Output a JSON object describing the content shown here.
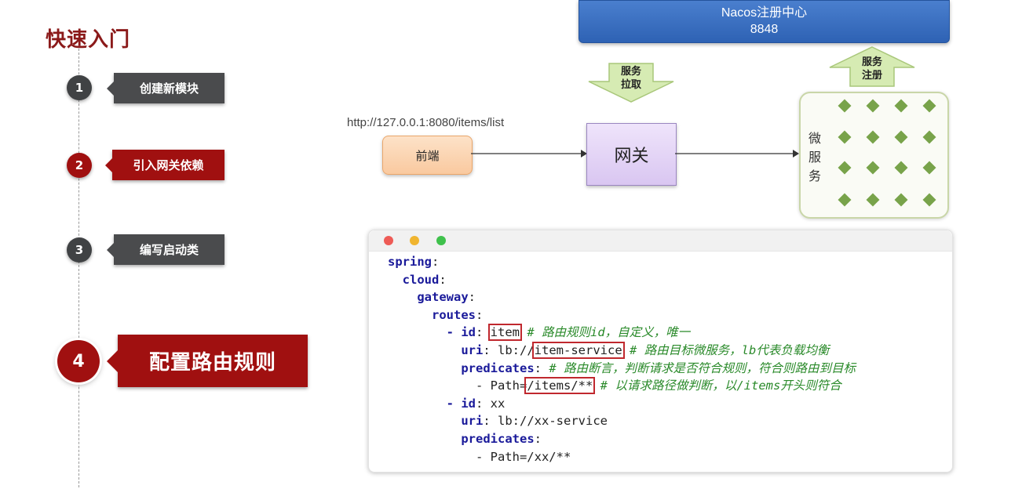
{
  "title": "快速入门",
  "steps": [
    {
      "num": "1",
      "label": "创建新模块"
    },
    {
      "num": "2",
      "label": "引入网关依赖"
    },
    {
      "num": "3",
      "label": "编写启动类"
    },
    {
      "num": "4",
      "label": "配置路由规则"
    }
  ],
  "diagram": {
    "registry_name": "Nacos注册中心",
    "registry_port": "8848",
    "pull_label_1": "服务",
    "pull_label_2": "拉取",
    "register_label_1": "服务",
    "register_label_2": "注册",
    "url": "http://127.0.0.1:8080/items/list",
    "frontend": "前端",
    "gateway": "网关",
    "microservices": [
      "微",
      "服",
      "务"
    ]
  },
  "code": {
    "spring": "spring",
    "cloud": "cloud",
    "gateway": "gateway",
    "routes": "routes",
    "r1_id_key": "- id",
    "r1_id_val": "item",
    "r1_id_comment": "# 路由规则id，自定义，唯一",
    "r1_uri_key": "uri",
    "r1_uri_prefix": "lb://",
    "r1_uri_val": "item-service",
    "r1_uri_comment": "# 路由目标微服务，lb代表负载均衡",
    "r1_pred_key": "predicates",
    "r1_pred_comment": "# 路由断言，判断请求是否符合规则，符合则路由到目标",
    "r1_path_prefix": "- Path=",
    "r1_path_val": "/items/**",
    "r1_path_comment": "# 以请求路径做判断，以/items开头则符合",
    "r2_id_key": "- id",
    "r2_id_val": "xx",
    "r2_uri_key": "uri",
    "r2_uri_val": "lb://xx-service",
    "r2_pred_key": "predicates",
    "r2_path": "- Path=/xx/**"
  },
  "colors": {
    "accent_red": "#a01010",
    "step_gray": "#4a4b4d",
    "nacos_blue": "#2e62b4",
    "arrow_green": "#c9e39a",
    "diamond_green": "#78a34a"
  }
}
